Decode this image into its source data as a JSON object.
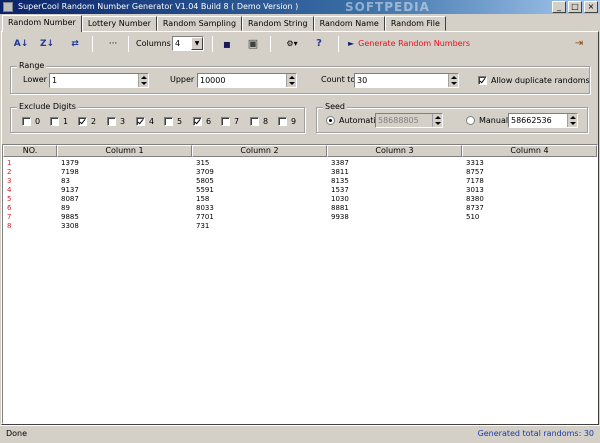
{
  "window": {
    "title": "SuperCool Random Number Generator V1.04 Build 8  ( Demo Version )",
    "watermark": "SOFTPEDIA",
    "minimize": "_",
    "maximize": "□",
    "close": "×"
  },
  "tabs": [
    "Random Number",
    "Lottery Number",
    "Random Sampling",
    "Random String",
    "Random Name",
    "Random File"
  ],
  "toolbar": {
    "sort_asc": "A↓",
    "sort_desc": "Z↓",
    "shuffle": "⇄",
    "more": "···",
    "columns_label": "Columns",
    "columns_value": "4",
    "save": "▪",
    "print": "▣",
    "options": "⚙▾",
    "help": "?",
    "generate_arrow": "►",
    "generate_label": "Generate Random Numbers",
    "exit": "⇥"
  },
  "range": {
    "title": "Range",
    "lower_label": "Lower",
    "lower_value": "1",
    "upper_label": "Upper",
    "upper_value": "10000",
    "count_label": "Count to",
    "count_value": "30",
    "allow_duplicates_label": "Allow duplicate randoms"
  },
  "exclude": {
    "title": "Exclude Digits",
    "digits": [
      "0",
      "1",
      "2",
      "3",
      "4",
      "5",
      "6",
      "7",
      "8",
      "9"
    ]
  },
  "seed": {
    "title": "Seed",
    "automatic_label": "Automatic",
    "automatic_value": "58688805",
    "manual_label": "Manual",
    "manual_value": "58662536"
  },
  "grid": {
    "headers": [
      "NO.",
      "Column 1",
      "Column 2",
      "Column 3",
      "Column 4"
    ],
    "rows": [
      [
        "1",
        "1379",
        "315",
        "3387",
        "3313"
      ],
      [
        "2",
        "7198",
        "3709",
        "3811",
        "8757"
      ],
      [
        "3",
        "83",
        "5805",
        "8135",
        "7178"
      ],
      [
        "4",
        "9137",
        "5591",
        "1537",
        "3013"
      ],
      [
        "5",
        "8087",
        "158",
        "1030",
        "8380"
      ],
      [
        "6",
        "89",
        "8033",
        "8881",
        "8737"
      ],
      [
        "7",
        "9885",
        "7701",
        "9938",
        "510"
      ],
      [
        "8",
        "3308",
        "731",
        "",
        ""
      ]
    ]
  },
  "status": {
    "left": "Done",
    "right": "Generated total randoms: 30"
  }
}
